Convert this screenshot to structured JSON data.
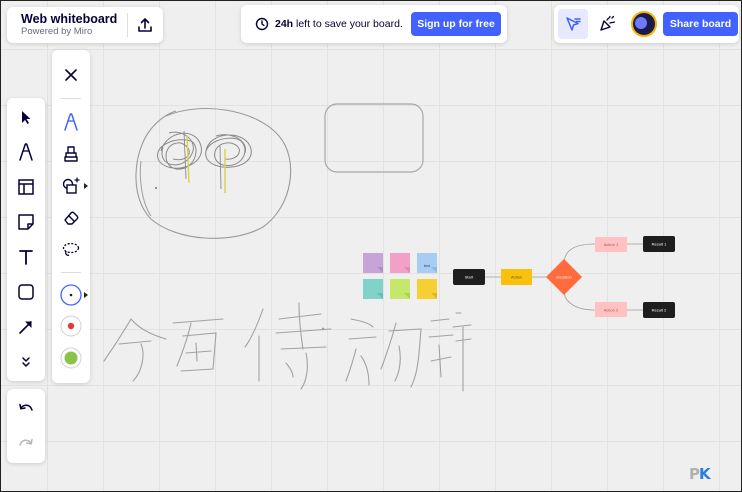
{
  "header": {
    "title": "Web whiteboard",
    "subtitle": "Powered by Miro"
  },
  "notice": {
    "time": "24h",
    "message": " left to save your board.",
    "signup_label": "Sign up for free"
  },
  "toolbar_right": {
    "share_label": "Share board"
  },
  "left_tools": [
    "select-icon",
    "pen-icon",
    "frame-icon",
    "sticky-note-icon",
    "text-icon",
    "shape-icon",
    "arrow-icon",
    "more-tools-icon"
  ],
  "pen_tools": [
    "close-icon",
    "pen-icon",
    "highlighter-icon",
    "smart-draw-icon",
    "eraser-icon",
    "lasso-icon"
  ],
  "pen_colors": {
    "stroke": "#222222",
    "red": "#e53935",
    "green": "#8bc34a"
  },
  "sticky_colors": [
    "#c6a4d8",
    "#f2a0c8",
    "#a8cdf5",
    "#7fd3c8",
    "#c5e86b",
    "#f6d033"
  ],
  "sticky_label": "text",
  "flowchart": {
    "start": "Start",
    "action": "Action",
    "decision": "Decision",
    "action1": "Action 1",
    "action2": "Action 2",
    "result1": "Result 1",
    "result2": "Result 2"
  },
  "watermark": {
    "p": "P",
    "k": "K"
  }
}
